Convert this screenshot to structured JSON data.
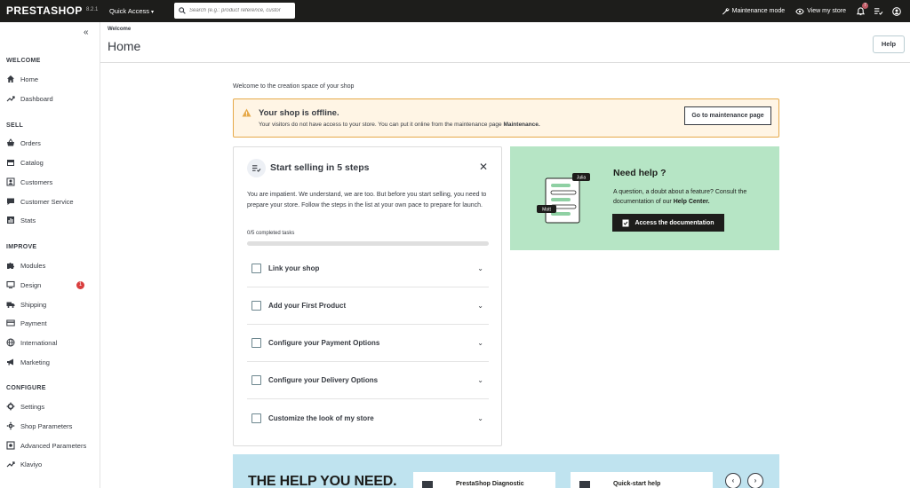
{
  "topbar": {
    "logo": "PRESTASHOP",
    "version": "8.2.1",
    "quick_access": "Quick Access",
    "search_placeholder": "Search (e.g.: product reference, custor",
    "maintenance_mode": "Maintenance mode",
    "view_store": "View my store",
    "notifications_count": "7"
  },
  "sidebar": {
    "sections": [
      {
        "title": "WELCOME",
        "items": [
          {
            "label": "Home",
            "icon": "home-icon"
          },
          {
            "label": "Dashboard",
            "icon": "trending-icon"
          }
        ]
      },
      {
        "title": "SELL",
        "items": [
          {
            "label": "Orders",
            "icon": "basket-icon"
          },
          {
            "label": "Catalog",
            "icon": "store-icon"
          },
          {
            "label": "Customers",
            "icon": "person-icon"
          },
          {
            "label": "Customer Service",
            "icon": "chat-icon"
          },
          {
            "label": "Stats",
            "icon": "bar-chart-icon"
          }
        ]
      },
      {
        "title": "IMPROVE",
        "items": [
          {
            "label": "Modules",
            "icon": "puzzle-icon"
          },
          {
            "label": "Design",
            "icon": "desktop-icon",
            "badge": "1"
          },
          {
            "label": "Shipping",
            "icon": "truck-icon"
          },
          {
            "label": "Payment",
            "icon": "credit-card-icon"
          },
          {
            "label": "International",
            "icon": "globe-icon"
          },
          {
            "label": "Marketing",
            "icon": "megaphone-icon"
          }
        ]
      },
      {
        "title": "CONFIGURE",
        "items": [
          {
            "label": "Settings",
            "icon": "gear-icon"
          },
          {
            "label": "Shop Parameters",
            "icon": "settings-icon"
          },
          {
            "label": "Advanced Parameters",
            "icon": "advanced-icon"
          },
          {
            "label": "Klaviyo",
            "icon": "trending-icon"
          }
        ]
      }
    ]
  },
  "header": {
    "breadcrumb": "Welcome",
    "title": "Home",
    "help": "Help"
  },
  "main": {
    "welcome": "Welcome to the creation space of your shop",
    "alert": {
      "title": "Your shop is offline.",
      "text": "Your visitors do not have access to your store. You can put it online from the maintenance page",
      "link": "Maintenance.",
      "button": "Go to maintenance page"
    },
    "steps": {
      "title": "Start selling in 5 steps",
      "description": "You are impatient. We understand, we are too. But before you start selling, you need to prepare your store. Follow the steps in the list at your own pace to prepare for launch.",
      "progress_label": "0/5 completed tasks",
      "progress": 0,
      "items": [
        "Link your shop",
        "Add your First Product",
        "Configure your Payment Options",
        "Configure your Delivery Options",
        "Customize the look of my store"
      ]
    },
    "help_card": {
      "title": "Need help ?",
      "text": "A question, a doubt about a feature? Consult the documentation of our",
      "link": "Help Center.",
      "button": "Access the documentation",
      "bubble1": "Julia",
      "bubble2": "Matt"
    },
    "banner": {
      "title": "THE HELP YOU NEED.",
      "cards": [
        "PrestaShop Diagnostic",
        "Quick-start help"
      ]
    }
  },
  "colors": {
    "accent": "#25b9d7",
    "alert_bg": "#fff5e5",
    "alert_border": "#e6a949",
    "help_bg": "#b6e5c5",
    "banner_bg": "#bfe3ef",
    "topbar_bg": "#1d1d1b"
  }
}
